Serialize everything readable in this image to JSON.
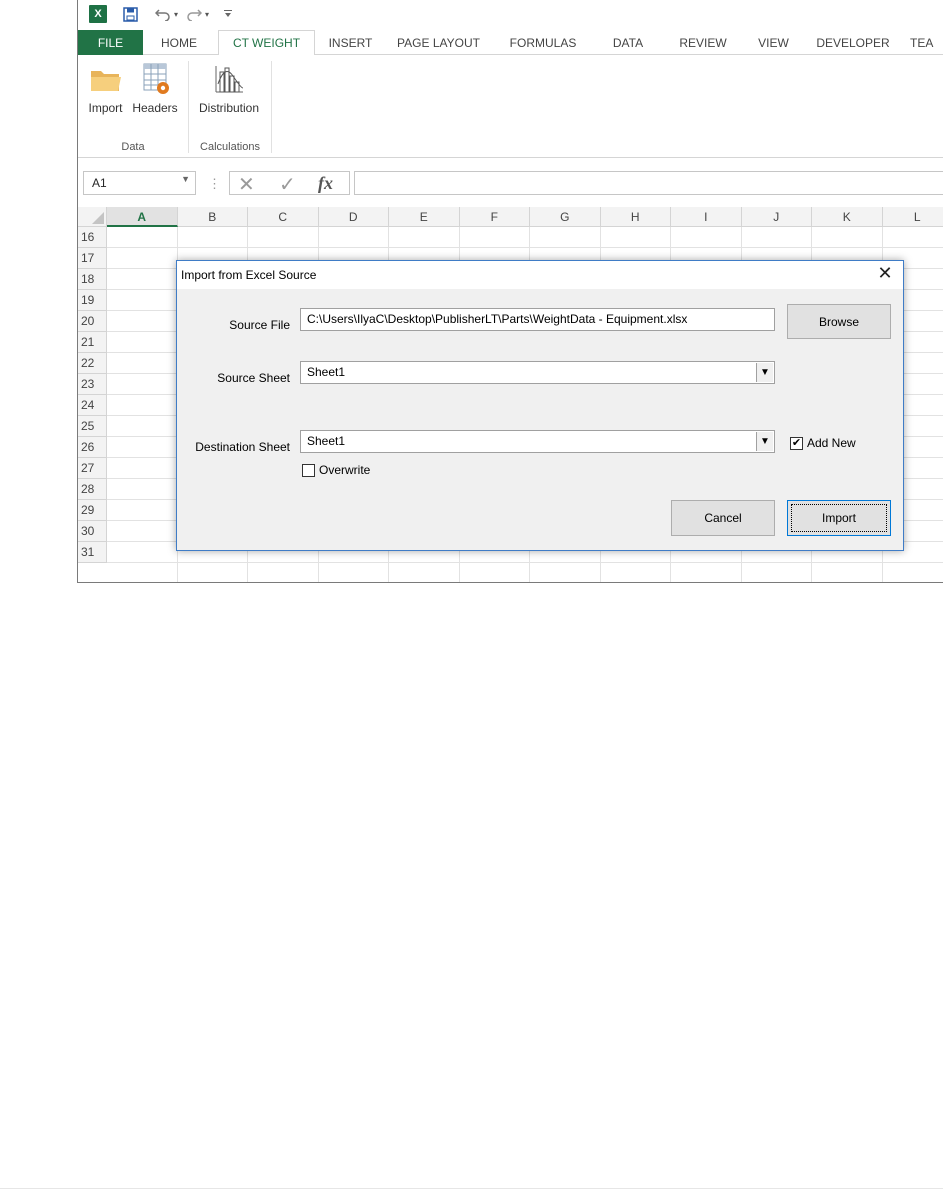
{
  "quick_access": {
    "excel_logo": "X█",
    "save_icon": "save-icon",
    "undo_icon": "undo-icon",
    "redo_icon": "redo-icon"
  },
  "ribbon_tabs": [
    "FILE",
    "HOME",
    "CT WEIGHT",
    "INSERT",
    "PAGE LAYOUT",
    "FORMULAS",
    "DATA",
    "REVIEW",
    "VIEW",
    "DEVELOPER",
    "TEA"
  ],
  "active_tab": "CT WEIGHT",
  "ribbon": {
    "import_label": "Import",
    "headers_label": "Headers",
    "distribution_label": "Distribution",
    "group_data": "Data",
    "group_calculations": "Calculations"
  },
  "formula_bar": {
    "name_box": "A1",
    "fx": "fx",
    "formula": ""
  },
  "grid": {
    "columns": [
      "A",
      "B",
      "C",
      "D",
      "E",
      "F",
      "G",
      "H",
      "I",
      "J",
      "K",
      "L"
    ],
    "selected_column": "A",
    "rows": [
      "16",
      "17",
      "18",
      "19",
      "20",
      "21",
      "22",
      "23",
      "24",
      "25",
      "26",
      "27",
      "28",
      "29",
      "30",
      "31"
    ]
  },
  "dialog": {
    "title": "Import from Excel Source",
    "source_file_label": "Source File",
    "source_file_value": "C:\\Users\\IlyaC\\Desktop\\PublisherLT\\Parts\\WeightData - Equipment.xlsx",
    "browse_label": "Browse",
    "source_sheet_label": "Source Sheet",
    "source_sheet_value": "Sheet1",
    "destination_sheet_label": "Destination Sheet",
    "destination_sheet_value": "Sheet1",
    "add_new_label": "Add New",
    "add_new_checked": true,
    "overwrite_label": "Overwrite",
    "overwrite_checked": false,
    "cancel_label": "Cancel",
    "import_label": "Import"
  },
  "colors": {
    "excel_green": "#217346",
    "dialog_border": "#3f7cc6",
    "dialog_bg": "#f0f0f0"
  }
}
